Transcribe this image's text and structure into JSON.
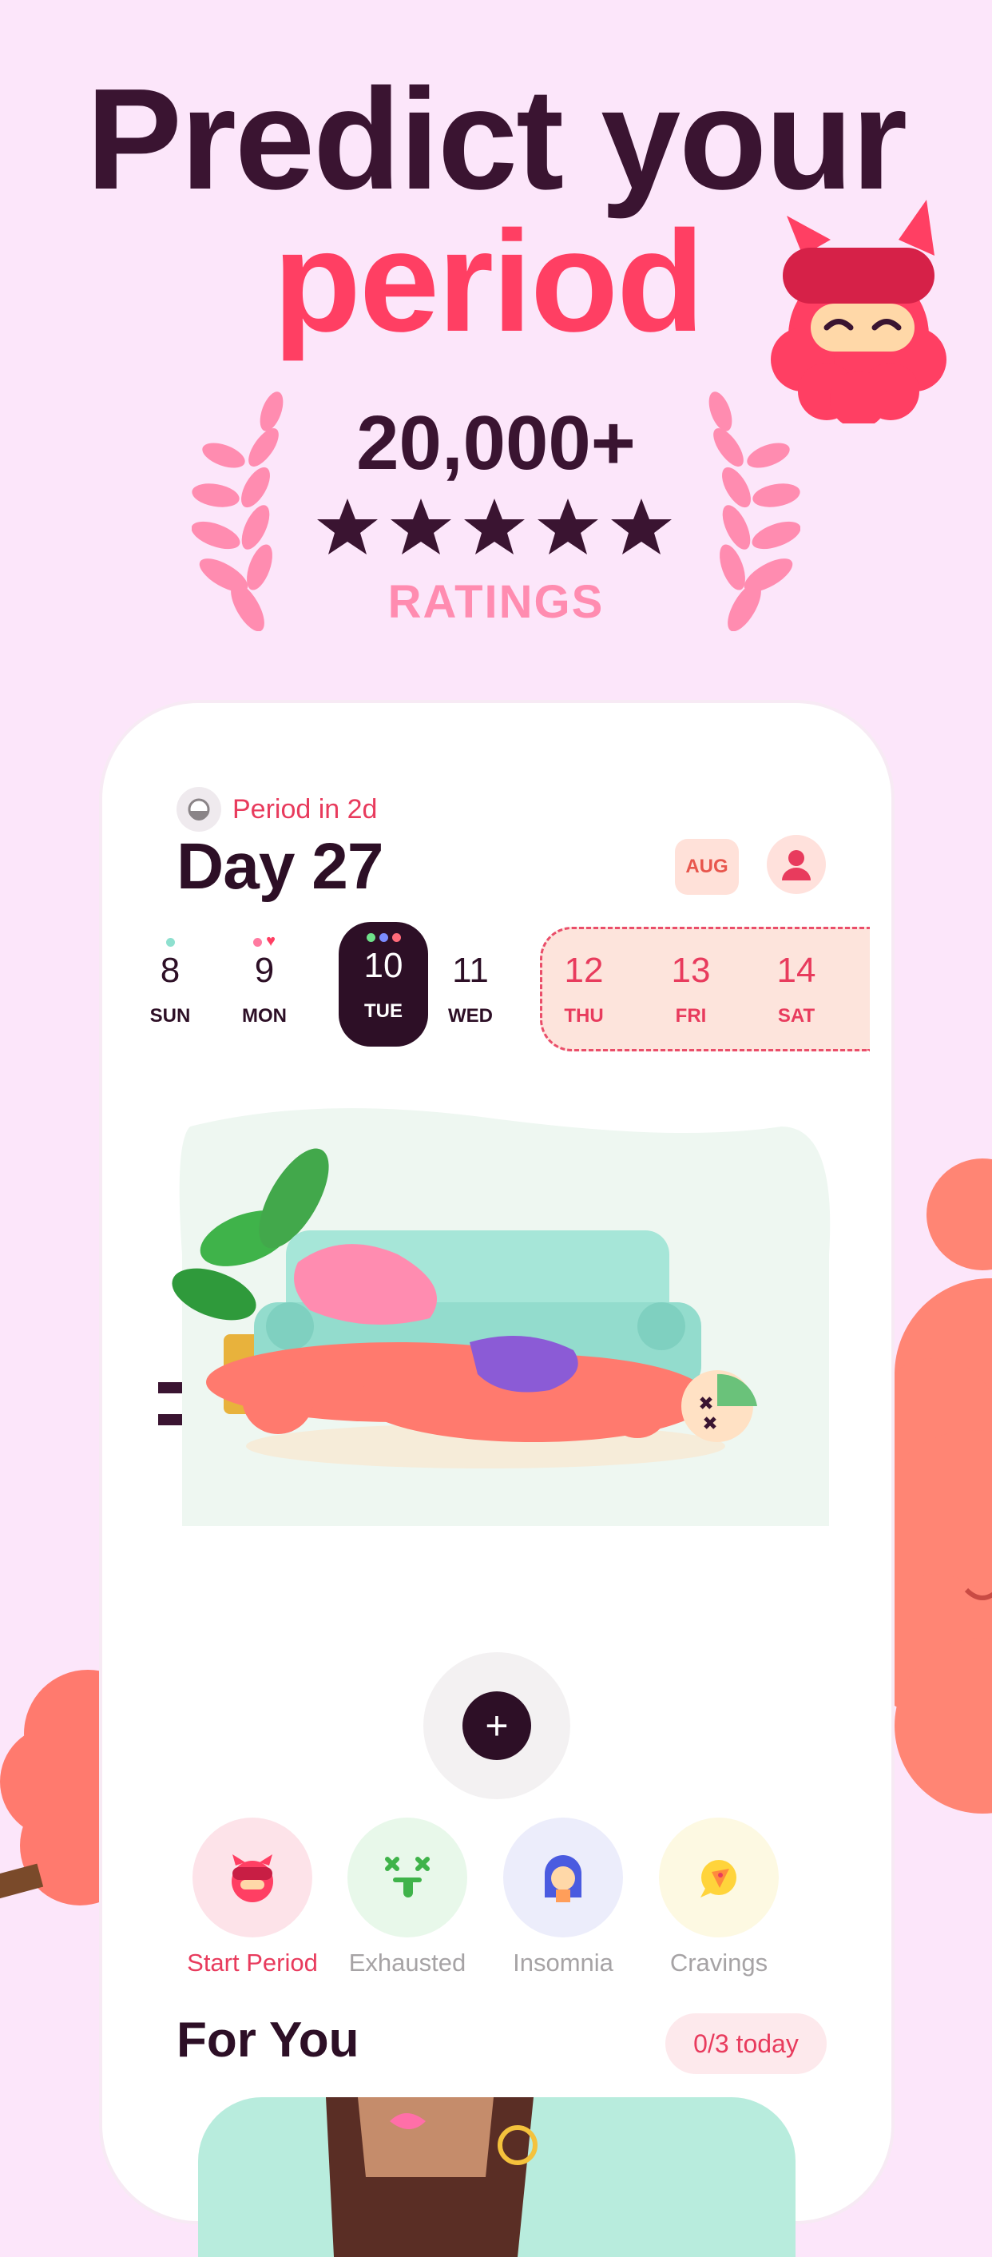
{
  "headline": {
    "line1": "Predict your",
    "line2": "period"
  },
  "ratings": {
    "count": "20,000+",
    "stars": 5,
    "label": "RATINGS"
  },
  "app": {
    "period_status": "Period in 2d",
    "day_title": "Day 27",
    "month_button": "AUG",
    "week": [
      {
        "num": "8",
        "name": "SUN",
        "dots": [
          "#8ee0cf"
        ]
      },
      {
        "num": "9",
        "name": "MON",
        "dots": [
          "#ff7aa0",
          "heart"
        ]
      },
      {
        "num": "10",
        "name": "TUE",
        "dots": [
          "#6fe08a",
          "#7b8cff",
          "#ff6b7a"
        ],
        "selected": true
      },
      {
        "num": "11",
        "name": "WED",
        "dots": []
      },
      {
        "num": "12",
        "name": "THU",
        "dots": [],
        "predicted": true
      },
      {
        "num": "13",
        "name": "FRI",
        "dots": [],
        "predicted": true
      },
      {
        "num": "14",
        "name": "SAT",
        "dots": [],
        "predicted": true
      }
    ],
    "add_button": "+",
    "quick_actions": [
      {
        "label": "Start Period",
        "icon": "ninja-icon"
      },
      {
        "label": "Exhausted",
        "icon": "exhausted-face-icon"
      },
      {
        "label": "Insomnia",
        "icon": "insomnia-face-icon"
      },
      {
        "label": "Cravings",
        "icon": "pizza-icon"
      }
    ],
    "for_you_title": "For You",
    "today_badge": "0/3 today"
  },
  "colors": {
    "background": "#fce6fa",
    "dark": "#2d0f26",
    "accent": "#ff3f63",
    "laurel": "#ff8cb0"
  }
}
